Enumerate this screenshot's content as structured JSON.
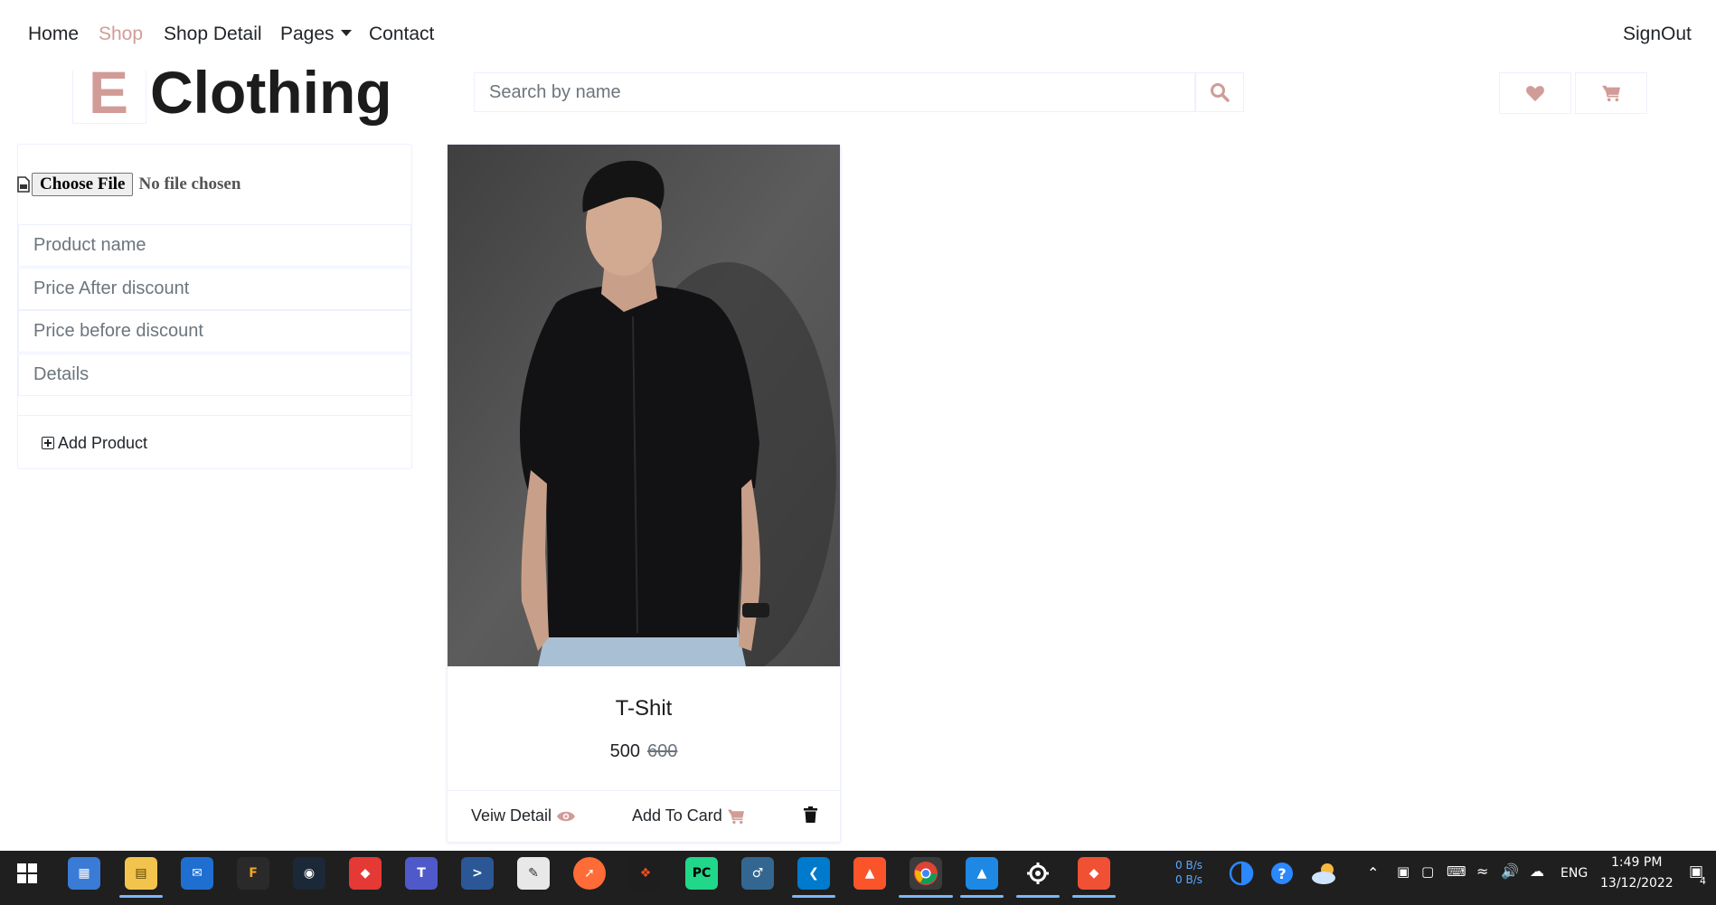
{
  "nav": {
    "home": "Home",
    "shop": "Shop",
    "shop_detail": "Shop Detail",
    "pages": "Pages",
    "contact": "Contact",
    "signout": "SignOut"
  },
  "brand": {
    "letter": "E",
    "name": "Clothing"
  },
  "search": {
    "placeholder": "Search by name"
  },
  "form": {
    "file_button": "Choose File",
    "file_status": "No file chosen",
    "product_name_placeholder": "Product name",
    "price_after_placeholder": "Price After discount",
    "price_before_placeholder": "Price before discount",
    "details_placeholder": "Details",
    "add_button": "Add Product"
  },
  "product": {
    "name": "T-Shit",
    "price": "500",
    "old_price": "600",
    "view_label": "Veiw Detail",
    "cart_label": "Add To Card"
  },
  "colors": {
    "accent": "#D19C97",
    "border": "#EDF1FF",
    "text_dark": "#1C1C1C"
  },
  "taskbar": {
    "net_up": "0 B/s",
    "net_down": "0 B/s",
    "lang": "ENG",
    "time": "1:49 PM",
    "date": "13/12/2022",
    "notifications": "4",
    "apps": [
      "windows-start",
      "microsoft-store",
      "file-explorer",
      "mail",
      "garena",
      "steam",
      "anydesk",
      "teams",
      "powershell",
      "notepad",
      "postman",
      "figma",
      "pycharm",
      "postgresql",
      "vscode",
      "brave",
      "chrome",
      "photos",
      "settings",
      "git"
    ]
  }
}
